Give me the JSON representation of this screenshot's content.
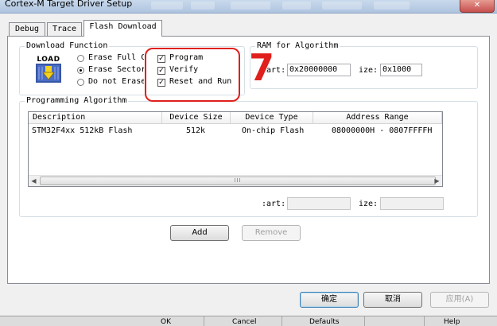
{
  "window": {
    "title": "Cortex-M Target Driver Setup",
    "close_glyph": "✕"
  },
  "tabs": [
    {
      "label": "Debug"
    },
    {
      "label": "Trace"
    },
    {
      "label": "Flash Download",
      "active": true
    }
  ],
  "download_function": {
    "group_label": "Download Function",
    "load_icon_text": "LOAD",
    "icon": "load-icon",
    "options": [
      {
        "label": "Erase Full C",
        "selected": false
      },
      {
        "label": "Erase Sector",
        "selected": true
      },
      {
        "label": "Do not Erase",
        "selected": false
      }
    ],
    "checkboxes": [
      {
        "label": "Program",
        "checked": true
      },
      {
        "label": "Verify",
        "checked": true
      },
      {
        "label": "Reset and Run",
        "checked": true
      }
    ]
  },
  "ram": {
    "group_label": "RAM for Algorithm",
    "start_label": ":art:",
    "start_value": "0x20000000",
    "size_label": "ize:",
    "size_value": "0x1000"
  },
  "programming": {
    "group_label": "Programming Algorithm",
    "columns": [
      "Description",
      "Device Size",
      "Device Type",
      "Address Range"
    ],
    "rows": [
      {
        "description": "STM32F4xx 512kB Flash",
        "size": "512k",
        "type": "On-chip Flash",
        "range": "08000000H - 0807FFFFH"
      }
    ],
    "scroll_grip": "III",
    "start_label": ":art:",
    "start_value": "",
    "size_label": "ize:",
    "size_value": "",
    "add_label": "Add",
    "remove_label": "Remove"
  },
  "dialog_buttons": {
    "ok": "确定",
    "cancel": "取消",
    "apply": "应用(A)"
  },
  "background_strip": {
    "ok": "OK",
    "cancel": "Cancel",
    "defaults": "Defaults",
    "help": "Help"
  },
  "annotation": {
    "digit": "7",
    "color": "#e0201c"
  },
  "colors": {
    "title_bar": "#aec4df",
    "dialog_bg": "#f0f0f0",
    "close_button": "#c75050"
  }
}
